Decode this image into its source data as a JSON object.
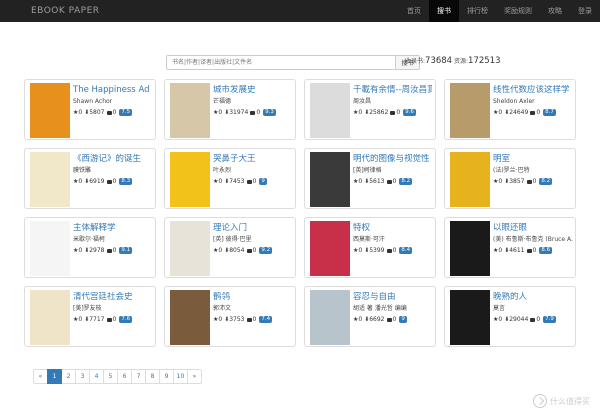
{
  "brand": "EBOOK   PAPER",
  "nav": [
    "首页",
    "搜书",
    "排行榜",
    "奖励规则",
    "攻略",
    "登录"
  ],
  "search": {
    "placeholder": "书名|作者|译者|出版社|文件名",
    "button": "搜书"
  },
  "stats": {
    "books_label": "收录书:",
    "books": "73684",
    "resources_label": "资源:",
    "resources": "172513"
  },
  "books": [
    {
      "title": "The Happiness Ad",
      "author": "Shawn Achor",
      "stars": "★0",
      "downloads": "⬇5807",
      "comments": "0",
      "score": "7.5",
      "cover_color": "#e8901e"
    },
    {
      "title": "城市发展史",
      "author": "芒福德",
      "stars": "★0",
      "downloads": "⬇31974",
      "comments": "0",
      "score": "9.3",
      "cover_color": "#d6c7a8"
    },
    {
      "title": "千載有余情--周汝昌賞",
      "author": "周汝昌",
      "stars": "★0",
      "downloads": "⬇25862",
      "comments": "0",
      "score": "9.6",
      "cover_color": "#dcdcdc"
    },
    {
      "title": "线性代数应该这样学",
      "author": "Sheldon Axler",
      "stars": "★0",
      "downloads": "⬇24649",
      "comments": "0",
      "score": "8.7",
      "cover_color": "#b89b6a"
    },
    {
      "title": "《西游记》的诞生",
      "author": "膜铁雕",
      "stars": "★0",
      "downloads": "⬇6919",
      "comments": "0",
      "score": "8.3",
      "cover_color": "#f0e8c8"
    },
    {
      "title": "哭鼻子大王",
      "author": "叶永烈",
      "stars": "★0",
      "downloads": "⬇7453",
      "comments": "0",
      "score": "9",
      "cover_color": "#f2c21b"
    },
    {
      "title": "明代的图像与视觉性",
      "author": "[英]柯律格",
      "stars": "★0",
      "downloads": "⬇5613",
      "comments": "0",
      "score": "8.2",
      "cover_color": "#3a3a3a"
    },
    {
      "title": "明室",
      "author": "(法)罗兰·巴特",
      "stars": "★0",
      "downloads": "⬇3857",
      "comments": "0",
      "score": "8.2",
      "cover_color": "#e6b31e"
    },
    {
      "title": "主体解释学",
      "author": "米歇尔·福柯",
      "stars": "★0",
      "downloads": "⬇2978",
      "comments": "0",
      "score": "9.1",
      "cover_color": "#f5f5f5"
    },
    {
      "title": "理论入门",
      "author": "[英] 彼得·巴里",
      "stars": "★0",
      "downloads": "⬇8054",
      "comments": "0",
      "score": "9.2",
      "cover_color": "#e8e3d8"
    },
    {
      "title": "特权",
      "author": "西莫斯·可汗",
      "stars": "★0",
      "downloads": "⬇5399",
      "comments": "0",
      "score": "8.4",
      "cover_color": "#c8304a"
    },
    {
      "title": "以眼还眼",
      "author": "(美) 布鲁斯·布鲁克 (Bruce A.",
      "stars": "★0",
      "downloads": "⬇4611",
      "comments": "0",
      "score": "8.6",
      "cover_color": "#1a1a1a"
    },
    {
      "title": "清代宫廷社会史",
      "author": "[美]罗友枝",
      "stars": "★0",
      "downloads": "⬇7717",
      "comments": "0",
      "score": "7.6",
      "cover_color": "#efe4c8"
    },
    {
      "title": "鹡鸰",
      "author": "郭沛文",
      "stars": "★0",
      "downloads": "⬇3753",
      "comments": "0",
      "score": "7.4",
      "cover_color": "#7a5c3c"
    },
    {
      "title": "容忍与自由",
      "author": "胡适 著 潘光哲 编编",
      "stars": "★0",
      "downloads": "⬇6692",
      "comments": "0",
      "score": "9",
      "cover_color": "#b8c4cc"
    },
    {
      "title": "晚熟的人",
      "author": "莫言",
      "stars": "★0",
      "downloads": "⬇29044",
      "comments": "0",
      "score": "7.9",
      "cover_color": "#1a1a1a"
    }
  ],
  "pagination": [
    "«",
    "1",
    "2",
    "3",
    "4",
    "5",
    "6",
    "7",
    "8",
    "9",
    "10",
    "»"
  ],
  "watermark": "什么值得买"
}
